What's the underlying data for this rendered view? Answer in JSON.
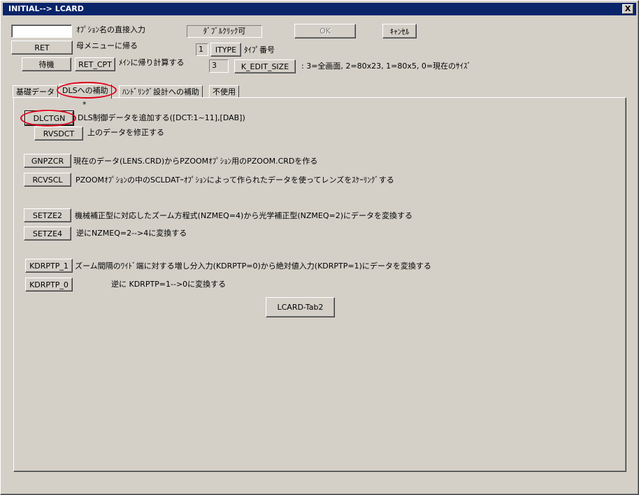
{
  "window": {
    "title": "INITIAL--> LCARD",
    "close_glyph": "X"
  },
  "top": {
    "option_input_value": "",
    "option_direct_label": "ｵﾌﾟｼｮﾝ名の直接入力",
    "double_click_label": "ﾀﾞﾌﾞﾙｸﾘｯｸ可",
    "ok_label": "OK",
    "cancel_label": "ｷｬﾝｾﾙ",
    "ret_label": "RET",
    "ret_desc": "母メニューに帰る",
    "itype_value": "1",
    "itype_label": "ITYPE",
    "itype_desc": "ﾀｲﾌﾟ番号",
    "wait_label": "待機",
    "ret_cpt_label": "RET_CPT",
    "ret_cpt_desc": "ﾒｲﾝに帰り計算する",
    "kedit_value": "3",
    "kedit_label": "K_EDIT_SIZE",
    "kedit_desc": ": 3=全画面, 2=80x23, 1=80x5, 0=現在のｻｲｽﾞ"
  },
  "tabs": [
    {
      "label": "基礎データ"
    },
    {
      "label": "DLSへの補助"
    },
    {
      "label": "ﾊﾝﾄﾞﾘﾝｸﾞ設計への補助"
    },
    {
      "label": "不使用"
    }
  ],
  "panel": {
    "asterisk": "*",
    "dlctgn_label": "DLCTGN",
    "dlctgn_desc": "DLS制御データを追加する([DCT:1~11],[DAB])",
    "rvsdct_label": "RVSDCT",
    "rvsdct_desc": "上のデータを修正する",
    "gnpzcr_label": "GNPZCR",
    "gnpzcr_desc": "現在のデータ(LENS.CRD)からPZOOMｵﾌﾟｼｮﾝ用のPZOOM.CRDを作る",
    "rcvscl_label": "RCVSCL",
    "rcvscl_desc": "PZOOMｵﾌﾟｼｮﾝの中のSCLDATｰｵﾌﾟｼｮﾝによって作られたデータを使ってレンズをｽｹｰﾘﾝｸﾞする",
    "setze2_label": "SETZE2",
    "setze2_desc": "機械補正型に対応したズーム方程式(NZMEQ=4)から光学補正型(NZMEQ=2)にデータを変換する",
    "setze4_label": "SETZE4",
    "setze4_desc": "逆にNZMEQ=2-->4に変換する",
    "kdrptp1_label": "KDRPTP_1",
    "kdrptp1_desc": "ズーム間隔のﾜｲﾄﾞ端に対する増し分入力(KDRPTP=0)から絶対値入力(KDRPTP=1)にデータを変換する",
    "kdrptp0_label": "KDRPTP_0",
    "kdrptp0_desc": "逆に KDRPTP=1-->0に変換する",
    "lcard_tab2_label": "LCARD-Tab2"
  },
  "colors": {
    "titlebar": "#0a246a",
    "face": "#d4d0c8",
    "highlight_oval": "#e0001a"
  }
}
